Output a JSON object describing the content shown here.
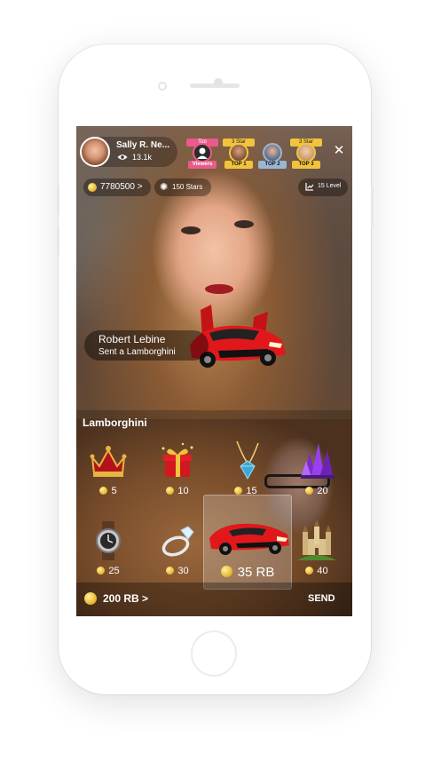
{
  "host": {
    "name": "Sally R. Ne...",
    "viewers": "13.1k"
  },
  "top_badges": [
    {
      "ribbon": "Top",
      "label": "Viewers"
    },
    {
      "ribbon": "3 Star",
      "label": "TOP 1"
    },
    {
      "ribbon": "",
      "label": "TOP 2"
    },
    {
      "ribbon": "3 Star",
      "label": "TOP 3"
    }
  ],
  "stats": {
    "coins": "7780500 >",
    "stars": "150 Stars",
    "level": "15 Level"
  },
  "notification": {
    "sender": "Robert Lebine",
    "message": "Sent a Lamborghini"
  },
  "gift_panel": {
    "title": "Lamborghini",
    "items": [
      {
        "name": "crown",
        "price": "5"
      },
      {
        "name": "gift-box",
        "price": "10"
      },
      {
        "name": "diamond-necklace",
        "price": "15"
      },
      {
        "name": "purple-crystals",
        "price": "20"
      },
      {
        "name": "watch",
        "price": "25"
      },
      {
        "name": "ring",
        "price": "30"
      },
      {
        "name": "lamborghini",
        "price": "35 RB"
      },
      {
        "name": "castle",
        "price": "40"
      }
    ],
    "balance": "200 RB >",
    "send_label": "SEND"
  },
  "colors": {
    "coin": "#f2c94c",
    "car": "#e0181c",
    "badge_gold": "#f2c33d"
  }
}
